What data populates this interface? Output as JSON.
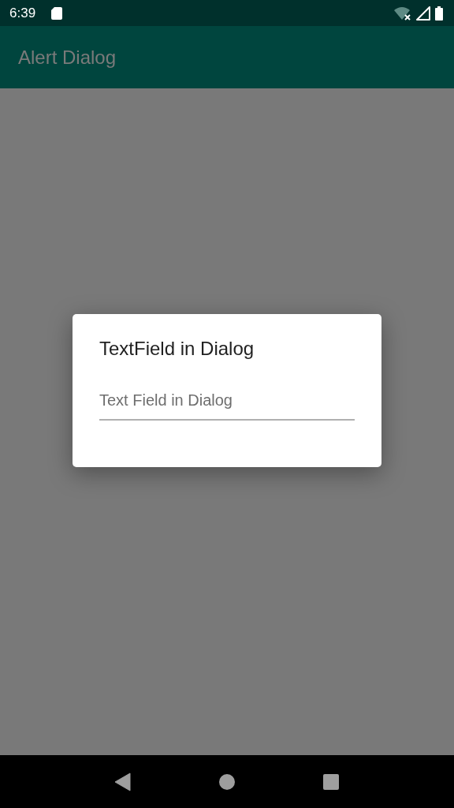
{
  "status_bar": {
    "time": "6:39"
  },
  "app_bar": {
    "title": "Alert Dialog"
  },
  "dialog": {
    "title": "TextField in Dialog",
    "field": {
      "placeholder": "Text Field in Dialog"
    }
  }
}
